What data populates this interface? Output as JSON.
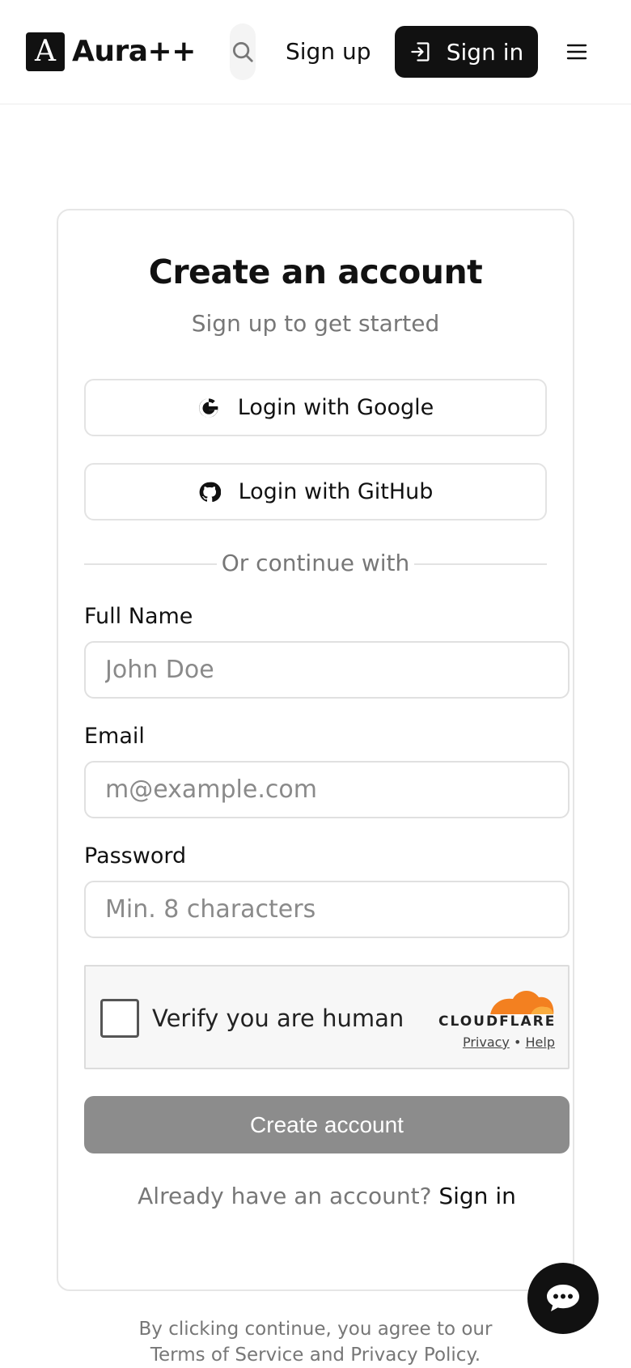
{
  "header": {
    "logo_letter": "A",
    "brand": "Aura++",
    "sign_up_label": "Sign up",
    "sign_in_label": "Sign in"
  },
  "form": {
    "title": "Create an account",
    "subtitle": "Sign up to get started",
    "google_label": "Login with Google",
    "github_label": "Login with GitHub",
    "divider_text": "Or continue with",
    "full_name_label": "Full Name",
    "full_name_placeholder": "John Doe",
    "email_label": "Email",
    "email_placeholder": "m@example.com",
    "password_label": "Password",
    "password_placeholder": "Min. 8 characters",
    "create_button": "Create account",
    "have_account_text": "Already have an account?",
    "sign_in_link": "Sign in"
  },
  "captcha": {
    "label": "Verify you are human",
    "brand": "CLOUDFLARE",
    "privacy": "Privacy",
    "separator": "•",
    "help": "Help"
  },
  "footer": {
    "terms_line1": "By clicking continue, you agree to our",
    "terms_line2": "Terms of Service and Privacy Policy."
  },
  "colors": {
    "primary": "#111111",
    "muted_text": "#777777",
    "disabled_button": "#8c8c8c",
    "cloudflare_orange": "#f38020"
  },
  "icons": [
    "search-icon",
    "sign-in-icon",
    "menu-icon",
    "google-icon",
    "github-icon",
    "chat-icon"
  ]
}
